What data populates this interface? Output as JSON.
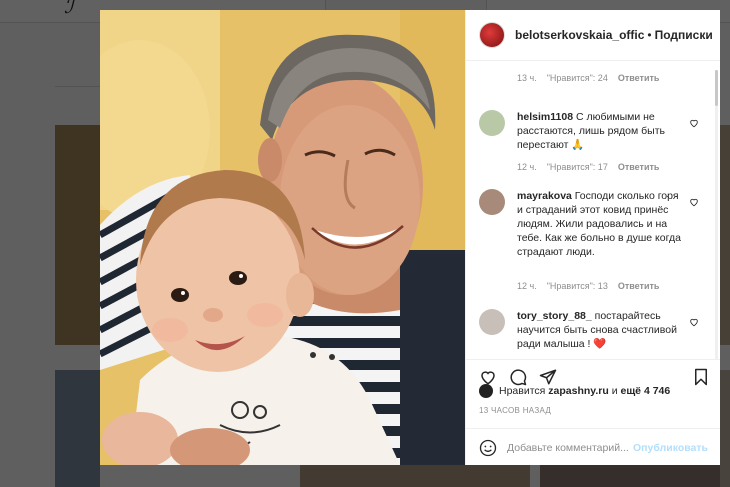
{
  "post": {
    "author": "belotserkovskaia_offic",
    "follow_label": "Подписки",
    "separator": "•"
  },
  "first_meta": {
    "time": "13 ч.",
    "likes": "\"Нравится\": 24",
    "reply": "Ответить"
  },
  "comments": [
    {
      "user": "helsim1108",
      "text": "С любимыми не расстаются, лишь рядом быть перестают 🙏",
      "time": "12 ч.",
      "likes": "\"Нравится\": 17",
      "reply": "Ответить",
      "avatar_color": "#b9c9a8"
    },
    {
      "user": "mayrakova",
      "text": "Господи сколько горя и страданий этот ковид принёс людям. Жили радовались и на тебе. Как же больно в душе когда страдают люди.",
      "time": "12 ч.",
      "likes": "\"Нравится\": 13",
      "reply": "Ответить",
      "more": "···",
      "avatar_color": "#a88a7a"
    },
    {
      "user": "tory_story_88_",
      "text": "постарайтесь научится быть снова счастливой ради малыша ! ❤️",
      "avatar_color": "#c8bfb8"
    }
  ],
  "actions": {
    "like_icon": "heart-icon",
    "comment_icon": "comment-icon",
    "share_icon": "share-icon",
    "save_icon": "bookmark-icon"
  },
  "likes_summary": {
    "prefix": "Нравится",
    "user": "zapashny.ru",
    "middle": "и",
    "rest": "ещё 4 746"
  },
  "date": "13 ЧАСОВ НАЗАД",
  "add_comment": {
    "placeholder": "Добавьте комментарий...",
    "publish": "Опубликовать"
  },
  "colors": {
    "link_disabled": "#b2dffc",
    "heart": "#ed4956",
    "muted": "#8e8e8e"
  }
}
